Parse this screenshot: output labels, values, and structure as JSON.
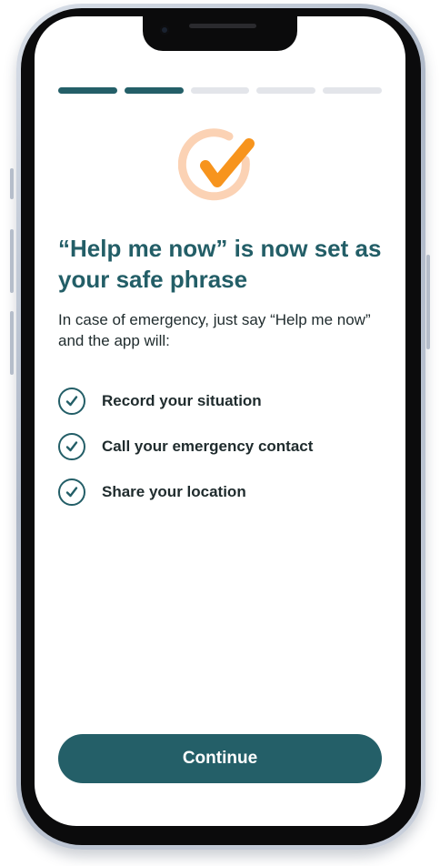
{
  "colors": {
    "primary": "#245f68",
    "accent": "#f7941d",
    "accent_ring": "#fbd2b4",
    "progress_inactive": "#e3e5ea"
  },
  "progress": {
    "total_steps": 5,
    "completed_steps": 2
  },
  "hero_icon": "orange-checkmark-icon",
  "title": "“Help me now” is now set as your safe phrase",
  "subtitle": "In case of emergency, just say “Help me now” and the app will:",
  "features": [
    {
      "icon": "check-circle-icon",
      "label": "Record your situation"
    },
    {
      "icon": "check-circle-icon",
      "label": "Call your emergency contact"
    },
    {
      "icon": "check-circle-icon",
      "label": "Share your location"
    }
  ],
  "continue_label": "Continue"
}
